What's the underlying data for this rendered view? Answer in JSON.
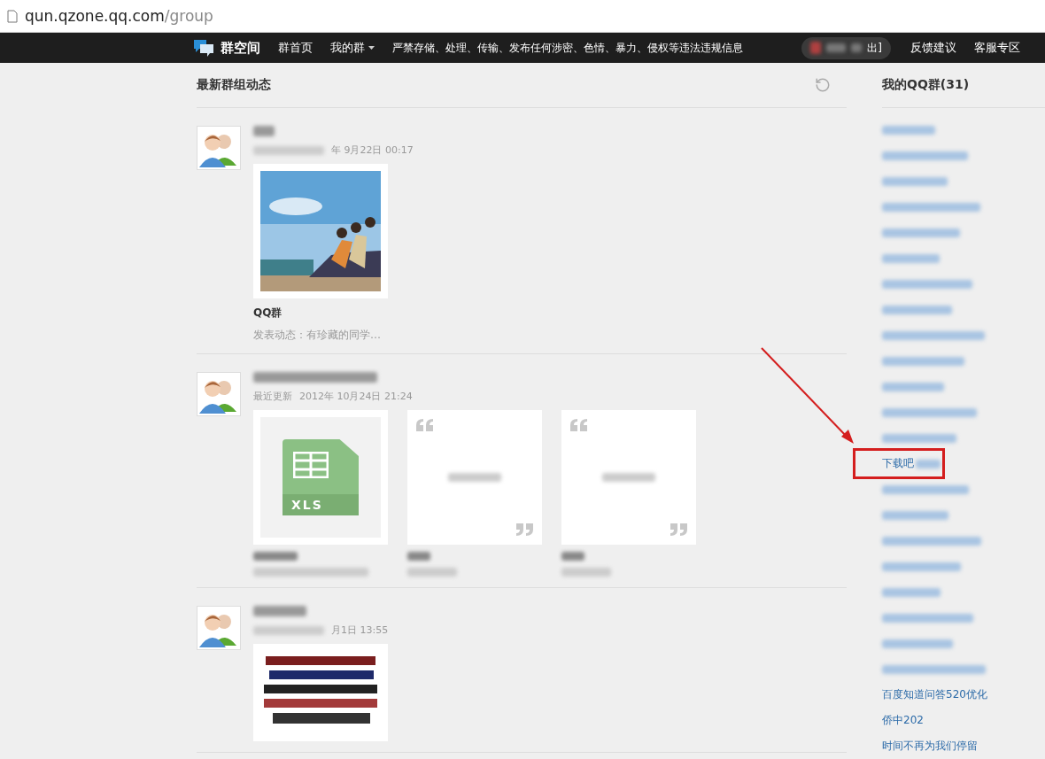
{
  "address_bar": {
    "url_host": "qun.qzone.qq.com",
    "url_path": "/group"
  },
  "nav": {
    "brand": "群空间",
    "links": [
      {
        "label": "群首页",
        "dropdown": false
      },
      {
        "label": "我的群",
        "dropdown": true
      }
    ],
    "notice": "严禁存储、处理、传输、发布任何涉密、色情、暴力、侵权等违法违规信息",
    "logout": "出]",
    "right_links": [
      "反馈建议",
      "客服专区"
    ]
  },
  "feed": {
    "title": "最新群组动态",
    "posts": [
      {
        "time": "年 9月22日 00:17",
        "attachments": [
          {
            "kind": "picture",
            "title": "QQ群",
            "caption": "发表动态：有珍藏的同学…"
          }
        ]
      },
      {
        "updated_label": "最近更新",
        "time": "2012年 10月24日 21:24",
        "attachments": [
          {
            "kind": "file",
            "file_type": "XLS"
          },
          {
            "kind": "quote"
          },
          {
            "kind": "quote"
          }
        ]
      },
      {
        "time": "月1日 13:55",
        "attachments": [
          {
            "kind": "ad_picture"
          }
        ]
      }
    ]
  },
  "sidebar": {
    "title": "我的QQ群",
    "count": "(31)",
    "items": [
      {
        "kind": "blurred",
        "highlighted": false
      },
      {
        "kind": "blurred",
        "highlighted": false
      },
      {
        "kind": "blurred",
        "highlighted": false
      },
      {
        "kind": "blurred",
        "highlighted": false
      },
      {
        "kind": "blurred",
        "highlighted": false
      },
      {
        "kind": "blurred",
        "highlighted": false
      },
      {
        "kind": "blurred",
        "highlighted": false
      },
      {
        "kind": "blurred",
        "highlighted": false
      },
      {
        "kind": "blurred",
        "highlighted": false
      },
      {
        "kind": "blurred",
        "highlighted": false
      },
      {
        "kind": "blurred",
        "highlighted": false
      },
      {
        "kind": "blurred",
        "highlighted": false
      },
      {
        "kind": "blurred",
        "highlighted": false
      },
      {
        "kind": "partial",
        "label": "下载吧",
        "highlighted": true
      },
      {
        "kind": "blurred",
        "highlighted": false
      },
      {
        "kind": "blurred",
        "highlighted": false
      },
      {
        "kind": "blurred",
        "highlighted": false
      },
      {
        "kind": "blurred",
        "highlighted": false
      },
      {
        "kind": "blurred",
        "highlighted": false
      },
      {
        "kind": "blurred",
        "highlighted": false
      },
      {
        "kind": "blurred",
        "highlighted": false
      },
      {
        "kind": "blurred",
        "highlighted": false
      },
      {
        "kind": "link",
        "label": "百度知道问答520优化",
        "highlighted": false
      },
      {
        "kind": "link",
        "label": "侨中202",
        "highlighted": false
      },
      {
        "kind": "link",
        "label": "时间不再为我们停留",
        "highlighted": false
      }
    ]
  }
}
